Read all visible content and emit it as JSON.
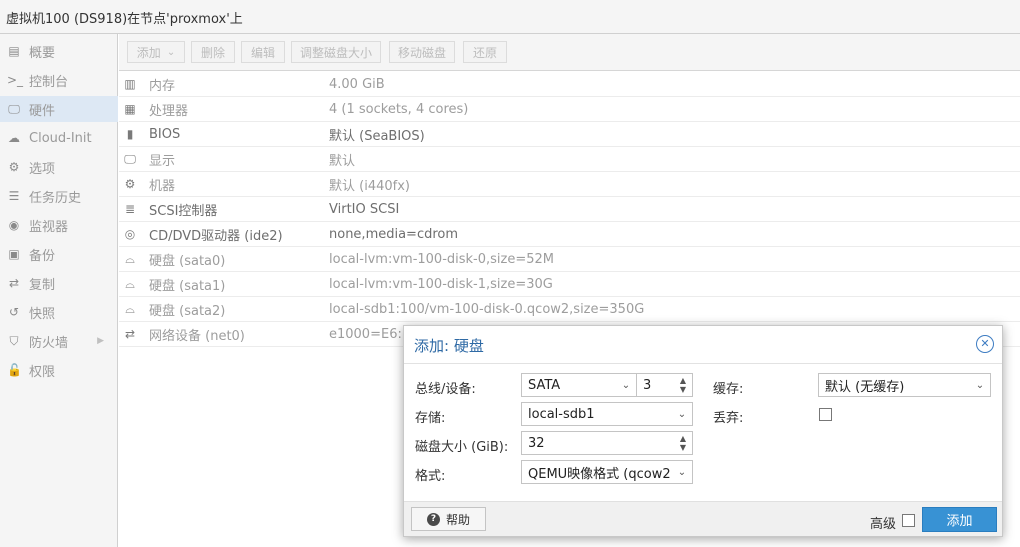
{
  "window": {
    "title": "虚拟机100 (DS918)在节点'proxmox'上"
  },
  "sidebar": {
    "items": [
      {
        "icon": "book-icon",
        "glyph": "▤",
        "label": "概要"
      },
      {
        "icon": "terminal-icon",
        "glyph": ">_",
        "label": "控制台"
      },
      {
        "icon": "desktop-icon",
        "glyph": "🖵",
        "label": "硬件",
        "active": true
      },
      {
        "icon": "cloud-icon",
        "glyph": "☁",
        "label": "Cloud-Init"
      },
      {
        "icon": "gear-icon",
        "glyph": "⚙",
        "label": "选项"
      },
      {
        "icon": "list-icon",
        "glyph": "☰",
        "label": "任务历史"
      },
      {
        "icon": "eye-icon",
        "glyph": "◉",
        "label": "监视器"
      },
      {
        "icon": "floppy-icon",
        "glyph": "▣",
        "label": "备份"
      },
      {
        "icon": "retweet-icon",
        "glyph": "⇄",
        "label": "复制"
      },
      {
        "icon": "history-icon",
        "glyph": "↺",
        "label": "快照"
      },
      {
        "icon": "shield-icon",
        "glyph": "⛉",
        "label": "防火墙",
        "arrow": "▶"
      },
      {
        "icon": "unlock-icon",
        "glyph": "🔓",
        "label": "权限"
      }
    ]
  },
  "toolbar": {
    "add": "添加",
    "add_arrow": "⌄",
    "remove": "删除",
    "edit": "编辑",
    "resize": "调整磁盘大小",
    "move": "移动磁盘",
    "revert": "还原"
  },
  "hardware": {
    "rows": [
      {
        "icon": "memory-icon",
        "glyph": "▥",
        "name": "内存",
        "value": "4.00 GiB"
      },
      {
        "icon": "cpu-icon",
        "glyph": "▦",
        "name": "处理器",
        "value": "4 (1 sockets, 4 cores)"
      },
      {
        "icon": "bios-icon",
        "glyph": "▮",
        "name": "BIOS",
        "value": "默认 (SeaBIOS)"
      },
      {
        "icon": "display-icon",
        "glyph": "🖵",
        "name": "显示",
        "value": "默认"
      },
      {
        "icon": "cogs-icon",
        "glyph": "⚙",
        "name": "机器",
        "value": "默认 (i440fx)"
      },
      {
        "icon": "database-icon",
        "glyph": "≣",
        "name": "SCSI控制器",
        "value": "VirtIO SCSI"
      },
      {
        "icon": "cdrom-icon",
        "glyph": "◎",
        "name": "CD/DVD驱动器 (ide2)",
        "value": "none,media=cdrom"
      },
      {
        "icon": "hdd-icon",
        "glyph": "⌓",
        "name": "硬盘 (sata0)",
        "value": "local-lvm:vm-100-disk-0,size=52M"
      },
      {
        "icon": "hdd-icon",
        "glyph": "⌓",
        "name": "硬盘 (sata1)",
        "value": "local-lvm:vm-100-disk-1,size=30G"
      },
      {
        "icon": "hdd-icon",
        "glyph": "⌓",
        "name": "硬盘 (sata2)",
        "value": "local-sdb1:100/vm-100-disk-0.qcow2,size=350G"
      },
      {
        "icon": "network-icon",
        "glyph": "⇄",
        "name": "网络设备 (net0)",
        "value": "e1000=E6:10"
      }
    ]
  },
  "dialog": {
    "title": "添加: 硬盘",
    "close_glyph": "✕",
    "bus_label": "总线/设备:",
    "bus_value": "SATA",
    "device_value": "3",
    "storage_label": "存储:",
    "storage_value": "local-sdb1",
    "size_label": "磁盘大小 (GiB):",
    "size_value": "32",
    "format_label": "格式:",
    "format_value": "QEMU映像格式 (qcow2",
    "cache_label": "缓存:",
    "cache_value": "默认 (无缓存)",
    "discard_label": "丢弃:",
    "discard_checked": false,
    "help_label": "帮助",
    "help_glyph": "?",
    "advanced_label": "高级",
    "advanced_checked": false,
    "add_label": "添加",
    "dropdown_glyph": "⌄",
    "spin_up": "▲",
    "spin_down": "▼"
  }
}
